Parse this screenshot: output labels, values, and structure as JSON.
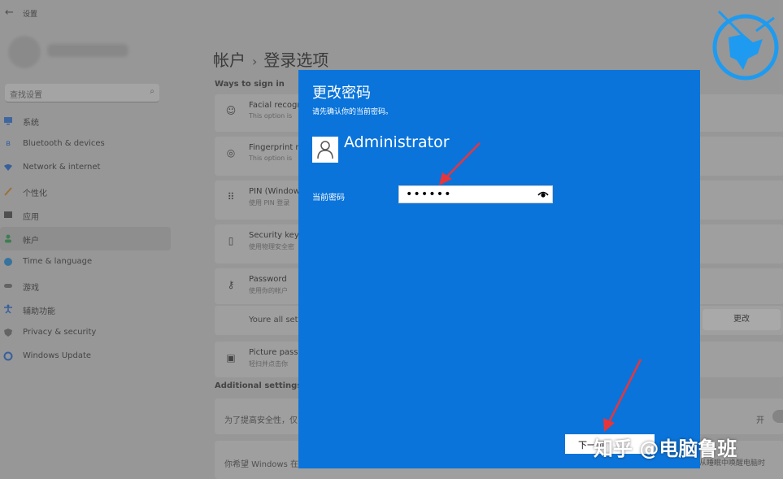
{
  "app": {
    "title": "设置"
  },
  "search": {
    "placeholder": "查找设置"
  },
  "nav": {
    "items": [
      {
        "label": "系统",
        "icon": "monitor-icon",
        "color": "#3a7bd5"
      },
      {
        "label": "Bluetooth & devices",
        "icon": "bluetooth-icon",
        "color": "#2e6fd0"
      },
      {
        "label": "Network & internet",
        "icon": "wifi-icon",
        "color": "#2e6fd0"
      },
      {
        "label": "个性化",
        "icon": "brush-icon",
        "color": "#d08a2e"
      },
      {
        "label": "应用",
        "icon": "apps-icon",
        "color": "#555555"
      },
      {
        "label": "帐户",
        "icon": "account-icon",
        "color": "#3aa05a"
      },
      {
        "label": "Time & language",
        "icon": "globe-clock-icon",
        "color": "#2e8fd0"
      },
      {
        "label": "游戏",
        "icon": "gamepad-icon",
        "color": "#777777"
      },
      {
        "label": "辅助功能",
        "icon": "accessibility-icon",
        "color": "#2e6fd0"
      },
      {
        "label": "Privacy & security",
        "icon": "shield-icon",
        "color": "#777777"
      },
      {
        "label": "Windows Update",
        "icon": "update-icon",
        "color": "#2e6fd0"
      }
    ],
    "selected_index": 5
  },
  "breadcrumb": {
    "parent": "帐户",
    "separator": "›",
    "current": "登录选项"
  },
  "ways": {
    "heading": "Ways to sign in",
    "cards": [
      {
        "title": "Facial recogn",
        "sub": "This option is",
        "icon": "face-icon"
      },
      {
        "title": "Fingerprint re",
        "sub": "This option is",
        "icon": "fingerprint-icon"
      },
      {
        "title": "PIN (Window",
        "sub": "使用 PIN 登录",
        "icon": "pin-icon"
      },
      {
        "title": "Security key",
        "sub": "使用物理安全密",
        "icon": "key-icon"
      },
      {
        "title": "Password",
        "sub": "使用你的帐户",
        "icon": "password-icon"
      },
      {
        "title": "Picture passw",
        "sub": "轻扫并点击你",
        "icon": "picture-icon"
      }
    ],
    "password_status": "Youre all set",
    "change_label": "更改"
  },
  "additional": {
    "heading": "Additional settings",
    "row1": "为了提高安全性，仅",
    "toggle_label": "开",
    "row2": "你希望 Windows 在",
    "row2_right": "从睡眠中唤醒电脑时"
  },
  "dialog": {
    "title": "更改密码",
    "subtitle": "请先确认你的当前密码。",
    "account_name": "Administrator",
    "password_label": "当前密码",
    "password_value": "••••••",
    "next_label": "下一页",
    "bg_color": "#0a74da"
  },
  "watermark": {
    "text": "知乎 @电脑鲁班"
  },
  "colors": {
    "arrow": "#e8353a",
    "dialog": "#0a74da"
  }
}
